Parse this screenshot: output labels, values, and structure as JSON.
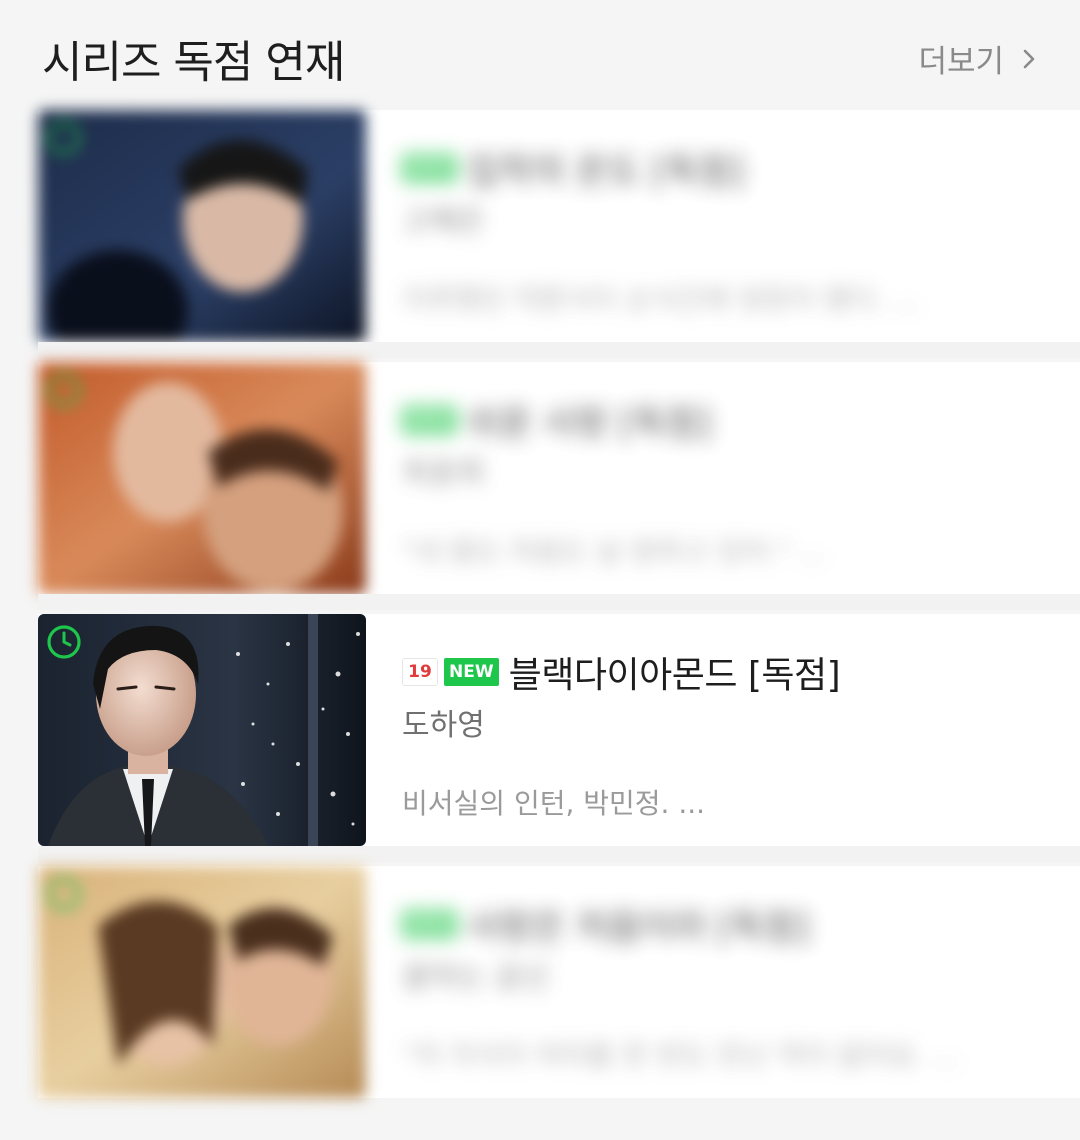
{
  "header": {
    "title": "시리즈 독점 연재",
    "more_label": "더보기"
  },
  "items": [
    {
      "title": "집착의 온도 [독점]",
      "author": "고혜은",
      "desc": "지루했던 약혼식이 순식간에 엉망이 됐다. ...",
      "badge": "NEW",
      "blurred": true
    },
    {
      "title": "쉬운 사랑 [독점]",
      "author": "최윤희",
      "desc": "\"내 몸도 마음도 날 원하고 있어.\" ...",
      "badge": "NEW",
      "blurred": true
    },
    {
      "title": "블랙다이아몬드 [독점]",
      "author": "도하영",
      "desc": "비서실의 인턴, 박민정. ...",
      "age_badge": "19",
      "badge": "NEW",
      "blurred": false
    },
    {
      "title": "사랑은 처음이라 [독점]",
      "author": "꿀하는 곰신",
      "desc": "\"저 자식이 여자를 한 번도 만난 적이 없어요. ...",
      "badge": "NEW",
      "blurred": true
    }
  ],
  "colors": {
    "new_badge": "#1ec74b",
    "age_badge_text": "#e23b3b",
    "wait_free_icon": "#1ec74b"
  },
  "icons": {
    "more": "chevron-right-icon",
    "wait_free": "clock-icon"
  }
}
